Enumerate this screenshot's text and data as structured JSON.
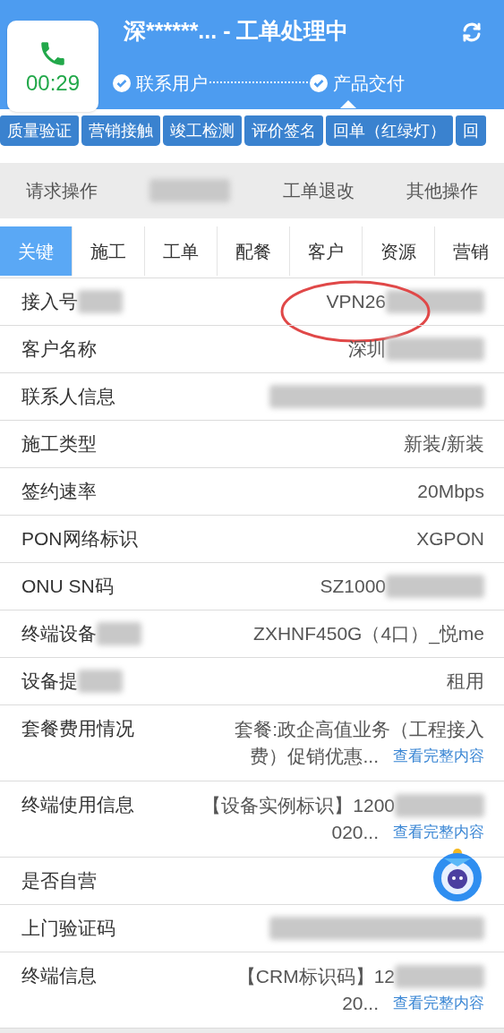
{
  "call": {
    "timer": "00:29"
  },
  "header": {
    "title": "深******... - 工单处理中"
  },
  "steps": [
    {
      "label": "联系用户",
      "done": true
    },
    {
      "label": "产品交付",
      "done": true
    }
  ],
  "action_tabs": [
    "质量验证",
    "营销接触",
    "竣工检测",
    "评价签名",
    "回单（红绿灯）",
    "回"
  ],
  "operations": [
    {
      "kind": "text",
      "label": "请求操作"
    },
    {
      "kind": "redacted"
    },
    {
      "kind": "text",
      "label": "工单退改"
    },
    {
      "kind": "text",
      "label": "其他操作"
    }
  ],
  "detail_tabs": [
    {
      "label": "关键",
      "selected": true
    },
    {
      "label": "施工",
      "selected": false
    },
    {
      "label": "工单",
      "selected": false
    },
    {
      "label": "配餐",
      "selected": false
    },
    {
      "label": "客户",
      "selected": false
    },
    {
      "label": "资源",
      "selected": false
    },
    {
      "label": "营销",
      "selected": false
    }
  ],
  "rows": [
    {
      "label": "接入号",
      "lines": [
        "VPN26"
      ],
      "blurred_label": true,
      "blurred_value": true,
      "highlighted": true
    },
    {
      "label": "客户名称",
      "lines": [
        "深圳"
      ],
      "blurred_value": true
    },
    {
      "label": "联系人信息",
      "blurred_value": true
    },
    {
      "label": "施工类型",
      "lines": [
        "新装/新装"
      ]
    },
    {
      "label": "签约速率",
      "lines": [
        "20Mbps"
      ]
    },
    {
      "label": "PON网络标识",
      "lines": [
        "XGPON"
      ]
    },
    {
      "label": "ONU SN码",
      "lines": [
        "SZ1000"
      ],
      "blurred_value": true
    },
    {
      "label": "终端设备",
      "lines": [
        "ZXHNF450G（4口）_悦me"
      ],
      "blurred_label": true
    },
    {
      "label": "设备提",
      "lines": [
        "租用"
      ],
      "blurred_label": true
    },
    {
      "label": "套餐费用情况",
      "lines": [
        "套餐:政企高值业务（工程接入",
        "费）促销优惠..."
      ],
      "link": "查看完整内容"
    },
    {
      "label": "终端使用信息",
      "lines": [
        "【设备实例标识】1200",
        "020..."
      ],
      "blurred_value": true,
      "link": "查看完整内容"
    },
    {
      "label": "是否自营"
    },
    {
      "label": "上门验证码",
      "blurred_value": true
    },
    {
      "label": "终端信息",
      "lines": [
        "【CRM标识码】12",
        "20..."
      ],
      "blurred_value": true,
      "link": "查看完整内容"
    }
  ]
}
